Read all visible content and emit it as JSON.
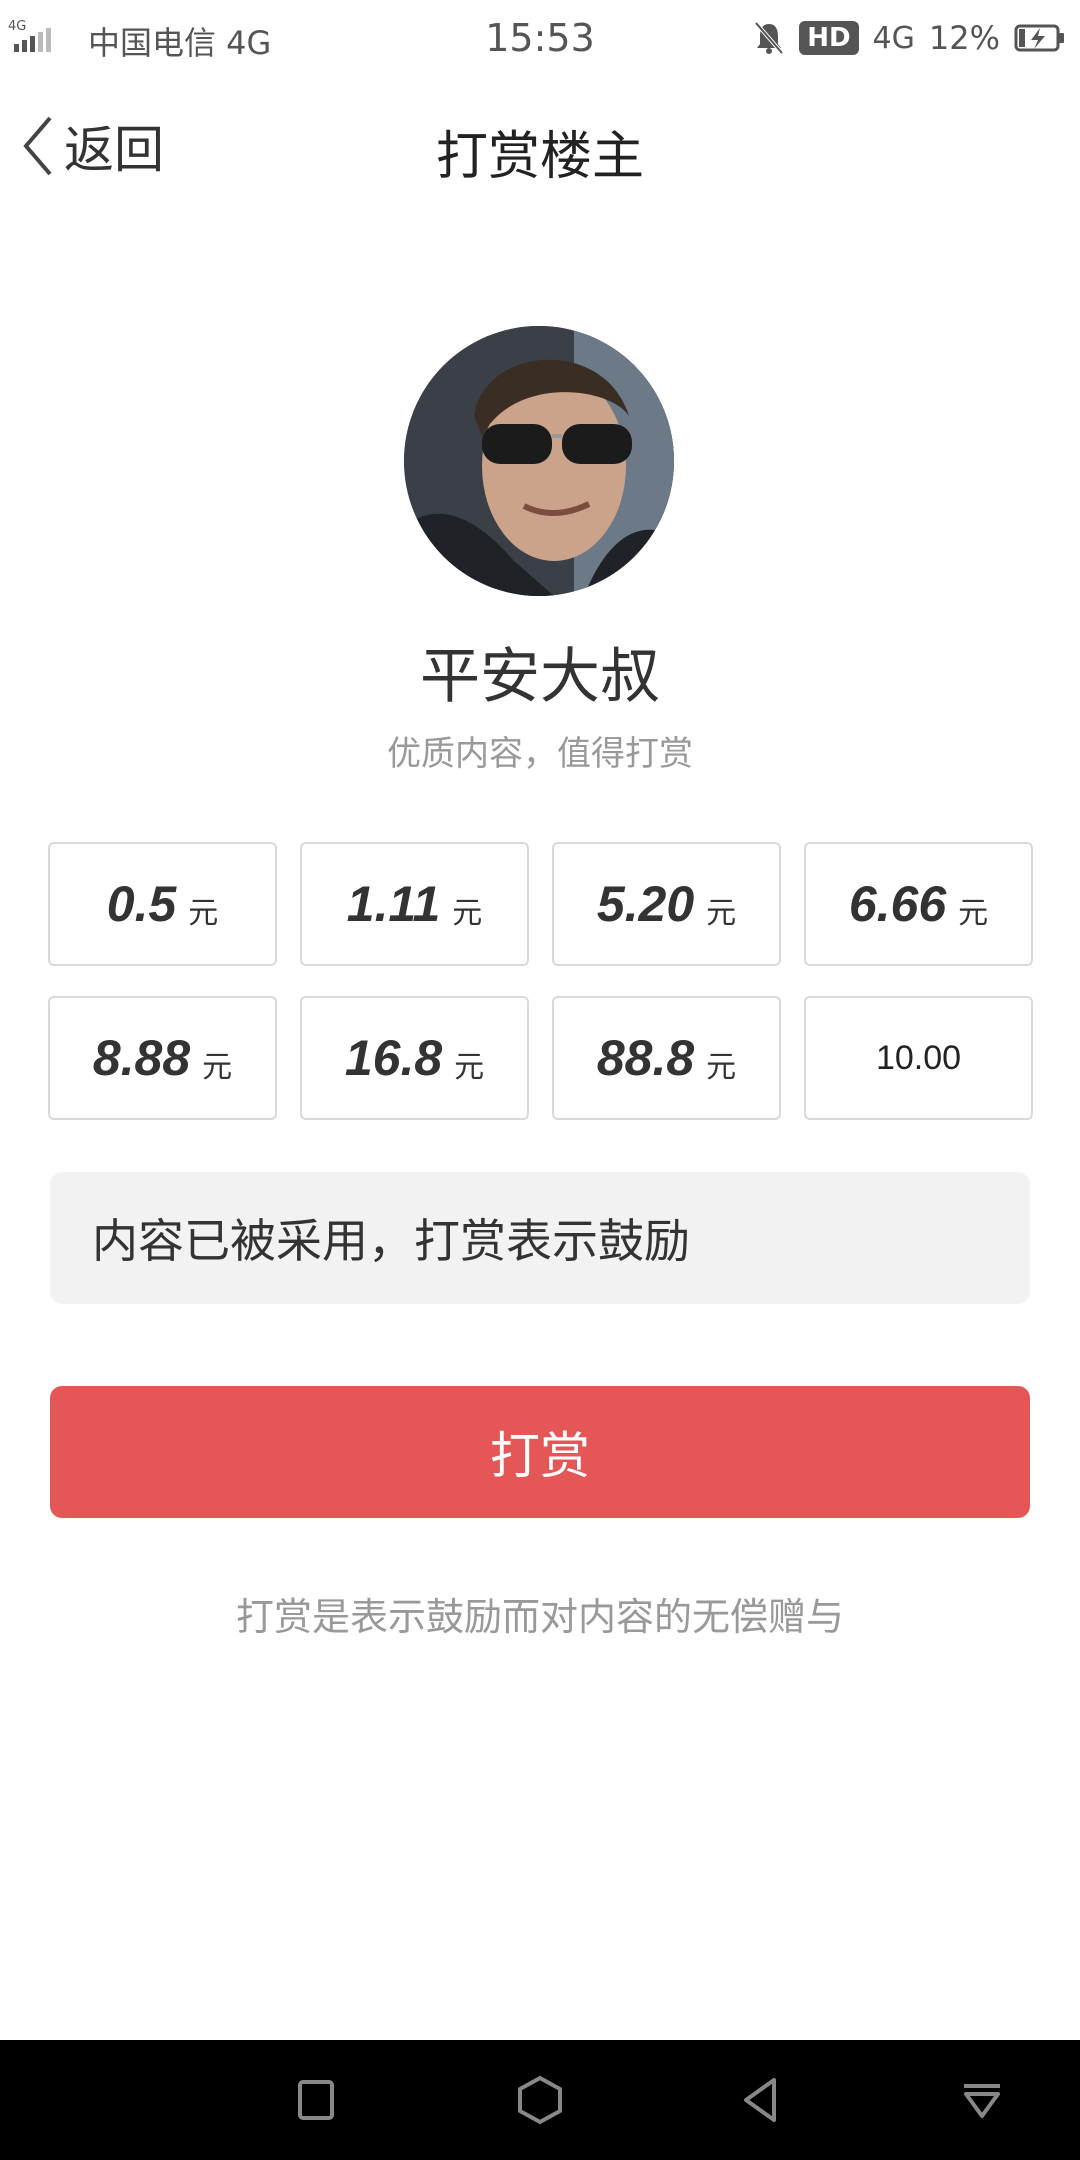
{
  "status_bar": {
    "signal_label": "4G",
    "carrier": "中国电信 4G",
    "time": "15:53",
    "hd_badge": "HD",
    "network": "4G",
    "battery_percent": "12%",
    "icons": [
      "signal-icon",
      "mute-bell-icon",
      "battery-charging-icon"
    ]
  },
  "nav": {
    "back_label": "返回",
    "title": "打赏楼主"
  },
  "profile": {
    "name": "平安大叔",
    "subtitle": "优质内容，值得打赏"
  },
  "amounts": [
    {
      "value": "0.5",
      "unit": "元"
    },
    {
      "value": "1.11",
      "unit": "元"
    },
    {
      "value": "5.20",
      "unit": "元"
    },
    {
      "value": "6.66",
      "unit": "元"
    },
    {
      "value": "8.88",
      "unit": "元"
    },
    {
      "value": "16.8",
      "unit": "元"
    },
    {
      "value": "88.8",
      "unit": "元"
    }
  ],
  "custom_amount": "10.00",
  "message": "内容已被采用，打赏表示鼓励",
  "reward_button": "打赏",
  "footer_note": "打赏是表示鼓励而对内容的无偿赠与",
  "colors": {
    "accent": "#e55757",
    "message_bg": "#f2f2f2",
    "border": "#d9d9d9"
  }
}
